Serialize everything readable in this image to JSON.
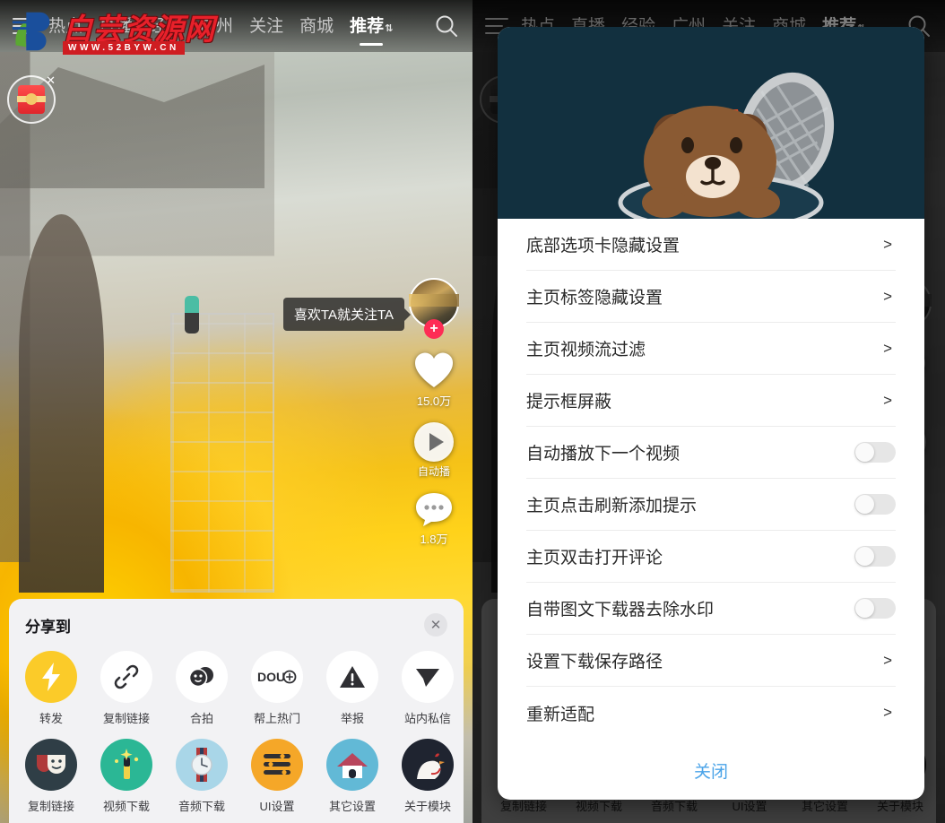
{
  "watermark": {
    "text": "白芸资源网",
    "url": "WWW.52BYW.CN",
    "close_icon": "close-icon"
  },
  "topnav": {
    "menu_icon": "hamburger-menu-icon",
    "search_icon": "search-icon",
    "items": [
      {
        "label": "热点",
        "active": false
      },
      {
        "label": "直播",
        "active": false
      },
      {
        "label": "经验",
        "active": false
      },
      {
        "label": "广州",
        "active": false
      },
      {
        "label": "关注",
        "active": false
      },
      {
        "label": "商城",
        "active": false
      },
      {
        "label": "推荐",
        "active": true,
        "caret": "⇅"
      }
    ]
  },
  "video": {
    "follow_tooltip": "喜欢TA就关注TA",
    "follow_plus": "+",
    "like_count": "15.0万",
    "comment_count": "1.8万",
    "music_label": "自动播",
    "gift_badge_icon": "gift-icon",
    "avatar_icon": "avatar",
    "heart_icon": "heart-icon",
    "play_icon": "play-icon",
    "comment_icon": "comment-icon"
  },
  "share_sheet": {
    "title": "分享到",
    "close_icon": "close-icon",
    "row1": [
      {
        "label": "转发",
        "icon": "lightning-bolt-icon",
        "bg": "#FBCB29"
      },
      {
        "label": "复制链接",
        "icon": "link-chain-icon",
        "bg": "#FFFFFF"
      },
      {
        "label": "合拍",
        "icon": "duet-faces-icon",
        "bg": "#FFFFFF"
      },
      {
        "label": "帮上热门",
        "icon": "dou-plus-icon",
        "bg": "#FFFFFF"
      },
      {
        "label": "举报",
        "icon": "warning-triangle-icon",
        "bg": "#FFFFFF"
      },
      {
        "label": "站内私信",
        "icon": "send-message-icon",
        "bg": "#FFFFFF"
      },
      {
        "label": "",
        "icon": "more-icon",
        "bg": "#FFFFFF"
      }
    ],
    "row2": [
      {
        "label": "复制链接",
        "icon": "masks-icon",
        "bg": "#2F3E46"
      },
      {
        "label": "视频下载",
        "icon": "sparkle-wand-icon",
        "bg": "#2BB795"
      },
      {
        "label": "音频下载",
        "icon": "watch-icon",
        "bg": "#A9D6E8"
      },
      {
        "label": "UI设置",
        "icon": "list-lines-icon",
        "bg": "#F5A728"
      },
      {
        "label": "其它设置",
        "icon": "home-icon",
        "bg": "#62B9D6"
      },
      {
        "label": "关于模块",
        "icon": "rooster-icon",
        "bg": "#1F2430"
      }
    ]
  },
  "dialog": {
    "hero_illustration": "bear-in-manhole-illustration",
    "hero_bg": "#12303F",
    "rows": [
      {
        "label": "底部选项卡隐藏设置",
        "type": "chevron",
        "value": ">"
      },
      {
        "label": "主页标签隐藏设置",
        "type": "chevron",
        "value": ">"
      },
      {
        "label": "主页视频流过滤",
        "type": "chevron",
        "value": ">"
      },
      {
        "label": "提示框屏蔽",
        "type": "chevron",
        "value": ">"
      },
      {
        "label": "自动播放下一个视频",
        "type": "toggle",
        "on": false
      },
      {
        "label": "主页点击刷新添加提示",
        "type": "toggle",
        "on": false
      },
      {
        "label": "主页双击打开评论",
        "type": "toggle",
        "on": false
      },
      {
        "label": "自带图文下载器去除水印",
        "type": "toggle",
        "on": false
      },
      {
        "label": "设置下载保存路径",
        "type": "chevron",
        "value": ">"
      },
      {
        "label": "重新适配",
        "type": "chevron",
        "value": ">"
      }
    ],
    "close_label": "关闭",
    "accent_color": "#4AA3E8"
  }
}
